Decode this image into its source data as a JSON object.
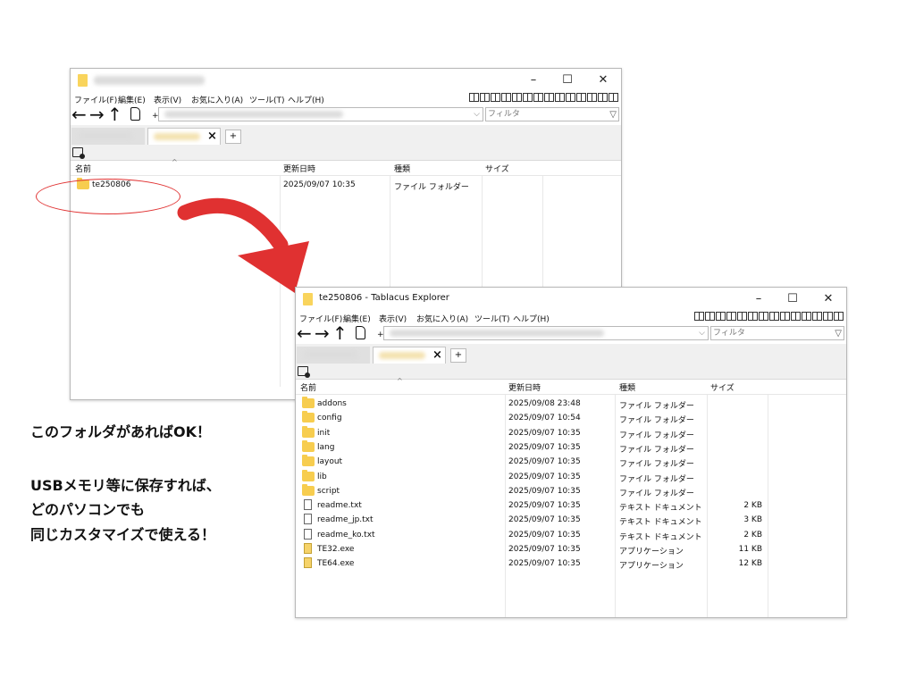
{
  "menu": [
    {
      "label": "ファイル(F)"
    },
    {
      "label": "編集(E)"
    },
    {
      "label": "表示(V)"
    },
    {
      "label": "お気に入り(A)"
    },
    {
      "label": "ツール(T)"
    },
    {
      "label": "ヘルプ(H)"
    }
  ],
  "filter_placeholder": "フィルタ",
  "columns": {
    "name": "名前",
    "modified": "更新日時",
    "type": "種類",
    "size": "サイズ"
  },
  "window1": {
    "rows": [
      {
        "name": "te250806",
        "modified": "2025/09/07 10:35",
        "type": "ファイル フォルダー",
        "size": "",
        "icon": "folder-icon"
      }
    ]
  },
  "window2": {
    "title": "te250806 - Tablacus Explorer",
    "rows": [
      {
        "name": "addons",
        "modified": "2025/09/08 23:48",
        "type": "ファイル フォルダー",
        "size": "",
        "icon": "folder-icon"
      },
      {
        "name": "config",
        "modified": "2025/09/07 10:54",
        "type": "ファイル フォルダー",
        "size": "",
        "icon": "folder-icon"
      },
      {
        "name": "init",
        "modified": "2025/09/07 10:35",
        "type": "ファイル フォルダー",
        "size": "",
        "icon": "folder-icon"
      },
      {
        "name": "lang",
        "modified": "2025/09/07 10:35",
        "type": "ファイル フォルダー",
        "size": "",
        "icon": "folder-icon"
      },
      {
        "name": "layout",
        "modified": "2025/09/07 10:35",
        "type": "ファイル フォルダー",
        "size": "",
        "icon": "folder-icon"
      },
      {
        "name": "lib",
        "modified": "2025/09/07 10:35",
        "type": "ファイル フォルダー",
        "size": "",
        "icon": "folder-icon"
      },
      {
        "name": "script",
        "modified": "2025/09/07 10:35",
        "type": "ファイル フォルダー",
        "size": "",
        "icon": "folder-icon"
      },
      {
        "name": "readme.txt",
        "modified": "2025/09/07 10:35",
        "type": "テキスト ドキュメント",
        "size": "2 KB",
        "icon": "text-file-icon"
      },
      {
        "name": "readme_jp.txt",
        "modified": "2025/09/07 10:35",
        "type": "テキスト ドキュメント",
        "size": "3 KB",
        "icon": "text-file-icon"
      },
      {
        "name": "readme_ko.txt",
        "modified": "2025/09/07 10:35",
        "type": "テキスト ドキュメント",
        "size": "2 KB",
        "icon": "text-file-icon"
      },
      {
        "name": "TE32.exe",
        "modified": "2025/09/07 10:35",
        "type": "アプリケーション",
        "size": "11 KB",
        "icon": "exe-icon"
      },
      {
        "name": "TE64.exe",
        "modified": "2025/09/07 10:35",
        "type": "アプリケーション",
        "size": "12 KB",
        "icon": "exe-icon"
      }
    ]
  },
  "caption": {
    "line1": "このフォルダがあればOK！",
    "line2": "USBメモリ等に保存すれば、",
    "line3": "どのパソコンでも",
    "line4": "同じカスタマイズで使える！"
  },
  "colors": {
    "highlight": "#e03131",
    "folder": "#f7cd4f",
    "chrome": "#f0f0f0"
  }
}
